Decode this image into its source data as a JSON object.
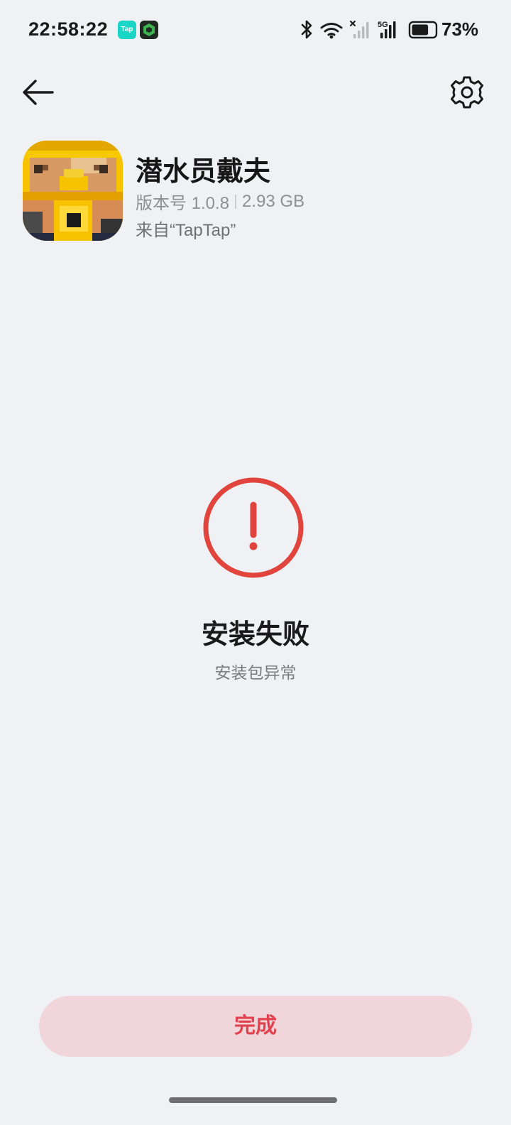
{
  "status_bar": {
    "time": "22:58:22",
    "notification_icons": [
      "taptap-icon",
      "cube-app-icon"
    ],
    "tap_icon_text": "Tap",
    "system_icons": [
      "bluetooth-icon",
      "wifi-icon",
      "cellular-signal-icon-sim1",
      "cellular-signal-icon-sim2"
    ],
    "network_type": "5G",
    "battery_level": 0.73,
    "battery_text": "73%"
  },
  "nav": {
    "back_icon": "back-arrow-icon",
    "settings_icon": "gear-icon"
  },
  "app": {
    "name": "潜水员戴夫",
    "version": "版本号 1.0.8",
    "size": "2.93 GB",
    "source": "来自“TapTap”"
  },
  "result": {
    "icon": "error-exclamation-icon",
    "title": "安装失败",
    "subtitle": "安装包异常"
  },
  "actions": {
    "done_label": "完成"
  },
  "colors": {
    "background": "#f0f1f4",
    "error_red": "#e0443c",
    "button_bg": "#f0d6da",
    "button_text": "#e0434f"
  }
}
